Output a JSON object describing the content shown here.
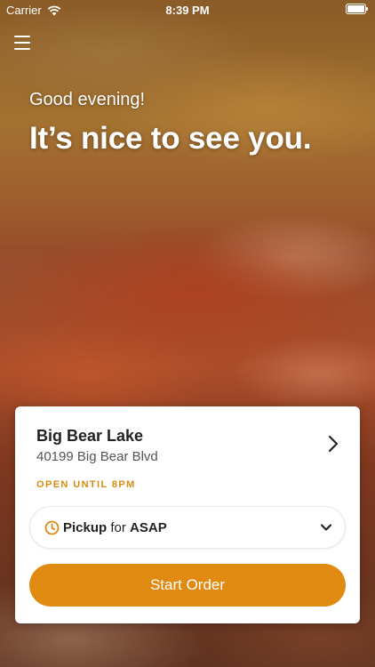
{
  "status_bar": {
    "carrier": "Carrier",
    "time": "8:39 PM",
    "icons": [
      "wifi-icon",
      "battery-icon"
    ]
  },
  "header": {
    "menu_icon": "hamburger-menu-icon"
  },
  "hero": {
    "greeting": "Good evening!",
    "headline": "It’s nice to see you."
  },
  "location_card": {
    "name": "Big Bear Lake",
    "address": "40199 Big Bear Blvd",
    "status": "OPEN UNTIL 8PM",
    "pickup": {
      "mode": "Pickup",
      "connector": "for",
      "time": "ASAP"
    },
    "start_button_label": "Start Order"
  },
  "colors": {
    "accent": "#e08a12",
    "status_text": "#d88a12",
    "card_bg": "#ffffff",
    "text_primary": "#222222"
  }
}
